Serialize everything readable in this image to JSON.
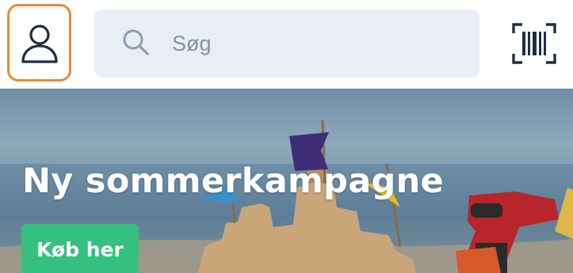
{
  "header": {
    "profile": {
      "icon": "user-icon"
    },
    "search": {
      "icon": "search-icon",
      "placeholder": "Søg"
    },
    "scanner": {
      "icon": "barcode-icon"
    }
  },
  "hero": {
    "title": "Ny sommerkampagne",
    "cta_label": "Køb her"
  },
  "colors": {
    "accent_outline": "#e58a3a",
    "search_bg": "#e9eef4",
    "cta_green": "#35c07f",
    "icon_dark": "#1f2f40"
  }
}
